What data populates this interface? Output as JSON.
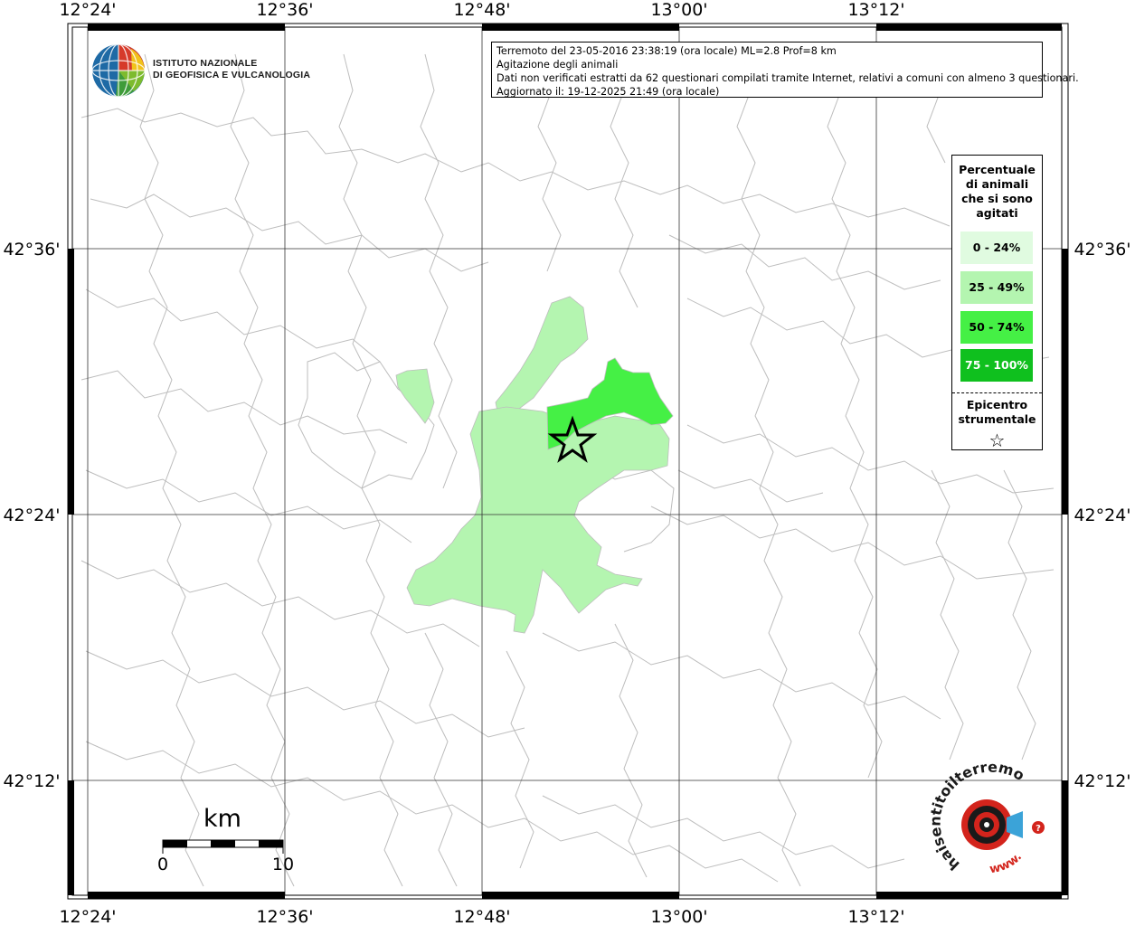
{
  "map": {
    "longitude_labels": [
      "12°24'",
      "12°36'",
      "12°48'",
      "13°00'",
      "13°12'"
    ],
    "latitude_labels": [
      "42°36'",
      "42°24'",
      "42°12'"
    ]
  },
  "info": {
    "line1": "Terremoto del 23-05-2016 23:38:19 (ora locale) ML=2.8 Prof=8 km",
    "line2": "Agitazione degli animali",
    "line3": "Dati non verificati estratti da 62 questionari compilati tramite Internet, relativi a comuni con almeno 3 questionari.",
    "line4": "Aggiornato il: 19-12-2025 21:49 (ora locale)"
  },
  "logo": {
    "ingv_line1": "ISTITUTO NAZIONALE",
    "ingv_line2": "DI GEOFISICA E VULCANOLOGIA",
    "hst_text": "haisentitoilterremoto.it",
    "hst_www": "www."
  },
  "legend": {
    "title_lines": [
      "Percentuale",
      "di animali",
      "che si sono",
      "agitati"
    ],
    "items": [
      {
        "label": "0 - 24%",
        "color": "#e0fbe0"
      },
      {
        "label": "25 - 49%",
        "color": "#b4f5b0"
      },
      {
        "label": "50 - 74%",
        "color": "#45f045"
      },
      {
        "label": "75 - 100%",
        "color": "#0fc01e"
      }
    ],
    "epicenter_lines": [
      "Epicentro",
      "strumentale"
    ],
    "epicenter_symbol": "☆"
  },
  "scale_bar": {
    "unit": "km",
    "min_label": "0",
    "max_label": "10"
  },
  "colors": {
    "border_lines": "#bdbdbd",
    "grid": "#333333",
    "fill_25_49": "#b4f5b0",
    "fill_50_74": "#45f045"
  }
}
